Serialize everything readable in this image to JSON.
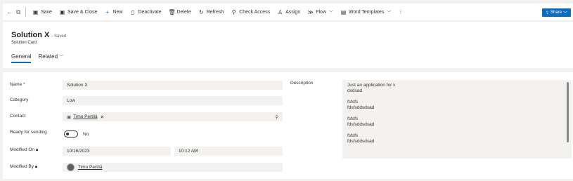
{
  "toolbar": {
    "back_icon": "back-arrow-icon",
    "popout_icon": "open-in-new-window-icon",
    "save": "Save",
    "save_close": "Save & Close",
    "new": "New",
    "deactivate": "Deactivate",
    "delete": "Delete",
    "refresh": "Refresh",
    "check_access": "Check Access",
    "assign": "Assign",
    "flow": "Flow",
    "word_templates": "Word Templates",
    "share": "Share"
  },
  "header": {
    "title": "Solution X",
    "status": "- Saved",
    "entity": "Solution Card",
    "tabs": [
      "General",
      "Related"
    ]
  },
  "form": {
    "name_label": "Name",
    "name_required": "*",
    "name_value": "Solution X",
    "category_label": "Category",
    "category_value": "Low",
    "contact_label": "Contact",
    "contact_value": "Timo Pertilä",
    "ready_label": "Ready for sending",
    "ready_value": "No",
    "modified_on_label": "Modified On",
    "modified_date": "10/16/2023",
    "modified_time": "10:12 AM",
    "modified_by_label": "Modified By",
    "modified_by_value": "Timo Pertilä",
    "description_label": "Description",
    "description_lines": [
      "Just an application for x\ndsdsad",
      "fsfsfs\nfdsfsddsdsad",
      "fsfsfs\nfdsfsddsdsad",
      "fsfsfs\nfdsfsddsdsad"
    ]
  },
  "colors": {
    "accent": "#0f6cbd",
    "required": "#a4262c"
  }
}
